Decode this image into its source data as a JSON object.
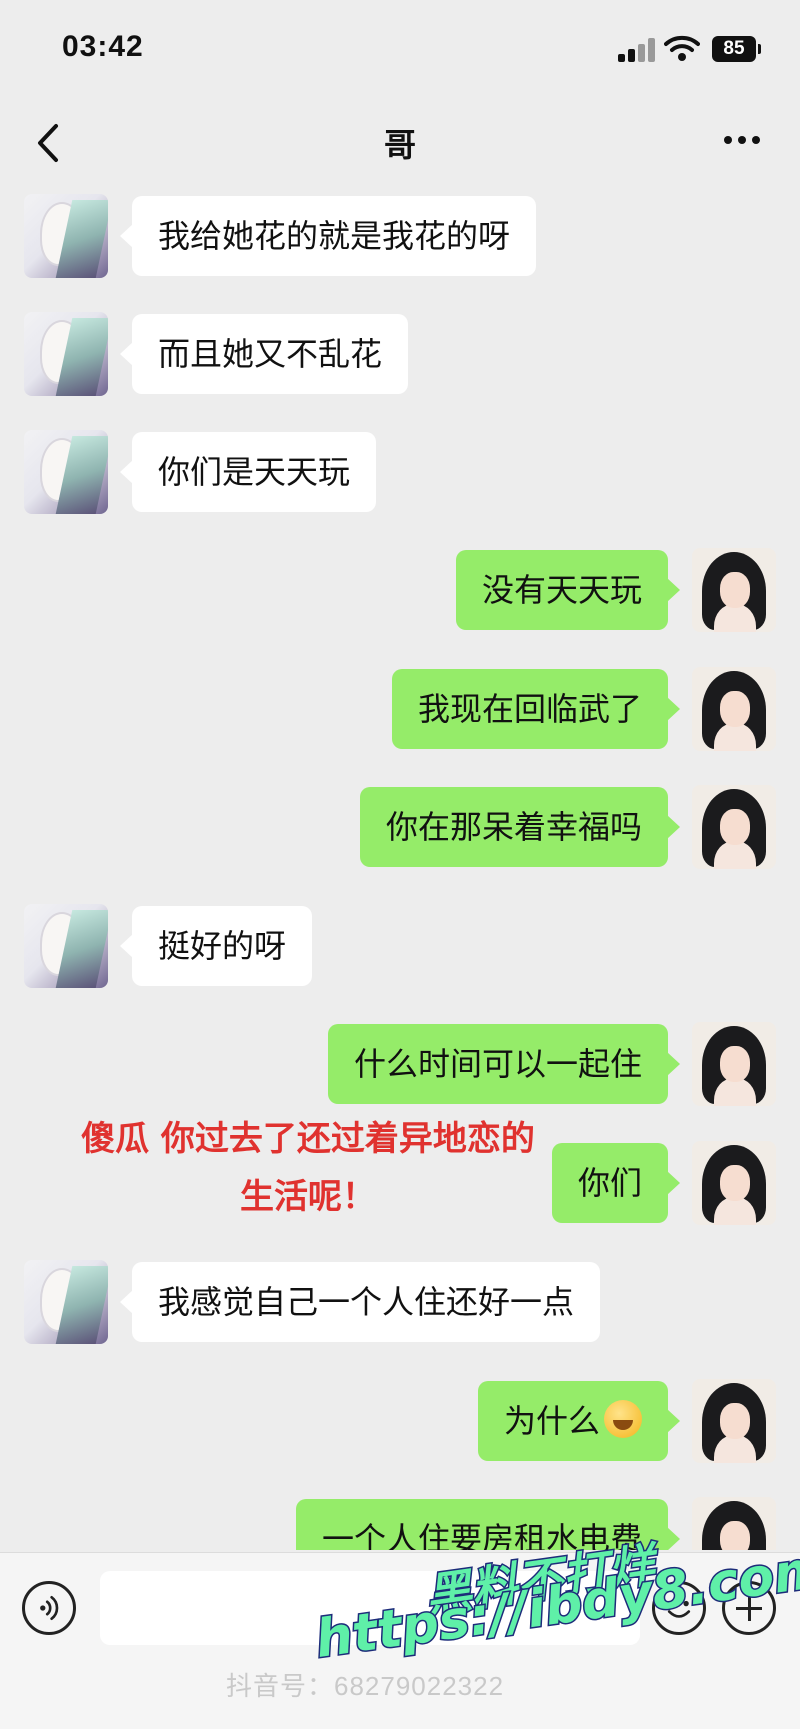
{
  "status_bar": {
    "time": "03:42",
    "battery": "85"
  },
  "header": {
    "title": "哥"
  },
  "messages": [
    {
      "side": "left",
      "text": "我给她花的就是我花的呀"
    },
    {
      "side": "left",
      "text": "而且她又不乱花"
    },
    {
      "side": "left",
      "text": "你们是天天玩"
    },
    {
      "side": "right",
      "text": "没有天天玩"
    },
    {
      "side": "right",
      "text": "我现在回临武了"
    },
    {
      "side": "right",
      "text": "你在那呆着幸福吗"
    },
    {
      "side": "left",
      "text": "挺好的呀"
    },
    {
      "side": "right",
      "text": "什么时间可以一起住"
    },
    {
      "side": "right",
      "text": "你们"
    },
    {
      "side": "left",
      "text": "我感觉自己一个人住还好一点"
    },
    {
      "side": "right",
      "text": "为什么"
    },
    {
      "side": "right",
      "text": "一个人住要房租水电费"
    }
  ],
  "overlay_caption": {
    "line1": "傻瓜 你过去了还过着异地恋的",
    "line2": "生活呢！"
  },
  "watermarks": {
    "douyin": "抖音号：68279022322",
    "site_name": "黑料不打烊",
    "site_url": "https://ibdy8.com"
  },
  "icons": {
    "back": "chevron-left-icon",
    "more": "more-dots-icon",
    "voice": "voice-icon",
    "emoji": "emoji-icon",
    "plus": "plus-icon"
  },
  "colors": {
    "own_bubble": "#95ec69",
    "other_bubble": "#ffffff",
    "background": "#ededed",
    "caption": "#e0322f"
  }
}
